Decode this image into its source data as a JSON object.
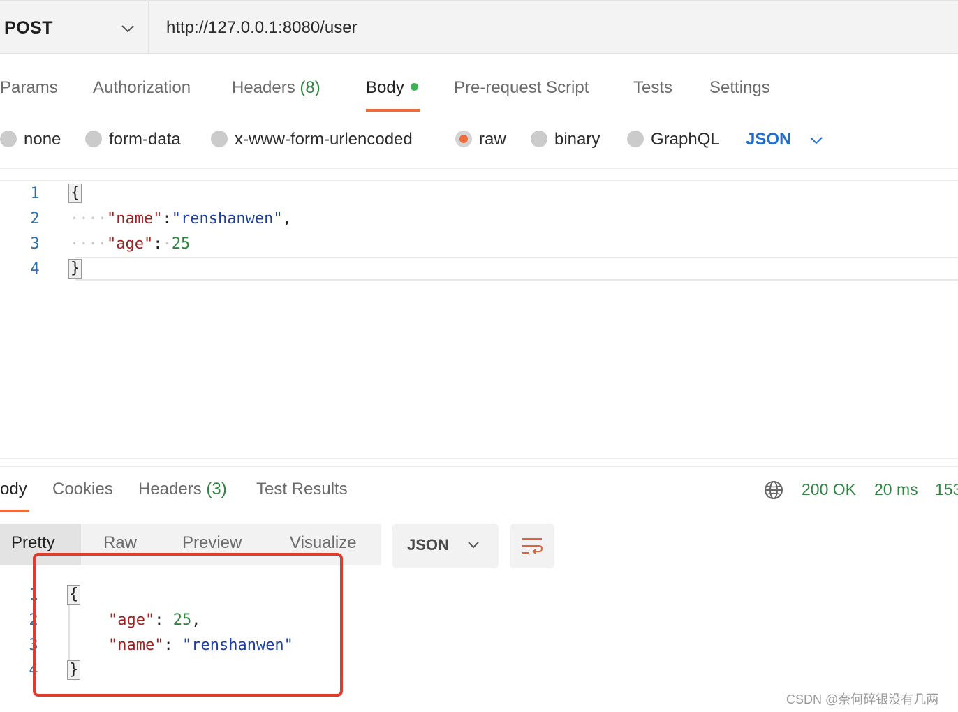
{
  "request": {
    "method": "POST",
    "url": "http://127.0.0.1:8080/user"
  },
  "request_tabs": [
    {
      "label": "Params"
    },
    {
      "label": "Authorization"
    },
    {
      "label": "Headers",
      "count": "(8)"
    },
    {
      "label": "Body",
      "active": true
    },
    {
      "label": "Pre-request Script"
    },
    {
      "label": "Tests"
    },
    {
      "label": "Settings"
    }
  ],
  "body_types": [
    {
      "label": "none"
    },
    {
      "label": "form-data"
    },
    {
      "label": "x-www-form-urlencoded"
    },
    {
      "label": "raw",
      "selected": true
    },
    {
      "label": "binary"
    },
    {
      "label": "GraphQL"
    }
  ],
  "body_language": "JSON",
  "request_body": {
    "line_numbers": [
      "1",
      "2",
      "3",
      "4"
    ],
    "open_brace": "{",
    "close_brace": "}",
    "name_key": "\"name\"",
    "name_value": "\"renshanwen\"",
    "age_key": "\"age\"",
    "age_value": "25"
  },
  "response_tabs": [
    {
      "label": "ody",
      "active": true
    },
    {
      "label": "Cookies"
    },
    {
      "label": "Headers",
      "count": "(3)"
    },
    {
      "label": "Test Results"
    }
  ],
  "response_status": {
    "code": "200 OK",
    "time": "20 ms",
    "size": "153"
  },
  "response_views": [
    "Pretty",
    "Raw",
    "Preview",
    "Visualize"
  ],
  "response_format": "JSON",
  "response_body": {
    "line_numbers": [
      "1",
      "2",
      "3",
      "4"
    ],
    "open_brace": "{",
    "close_brace": "}",
    "age_key": "\"age\"",
    "age_value": "25",
    "name_key": "\"name\"",
    "name_value": "\"renshanwen\""
  },
  "watermark": "CSDN @奈何碎银没有几两",
  "colors": {
    "accent": "#ef6c3a",
    "link_blue": "#1f6fd1",
    "success_green": "#2e8540",
    "annotation_red": "#e23a2b"
  },
  "icons": [
    "chevron-down-icon",
    "globe-icon",
    "wrap-lines-icon"
  ]
}
